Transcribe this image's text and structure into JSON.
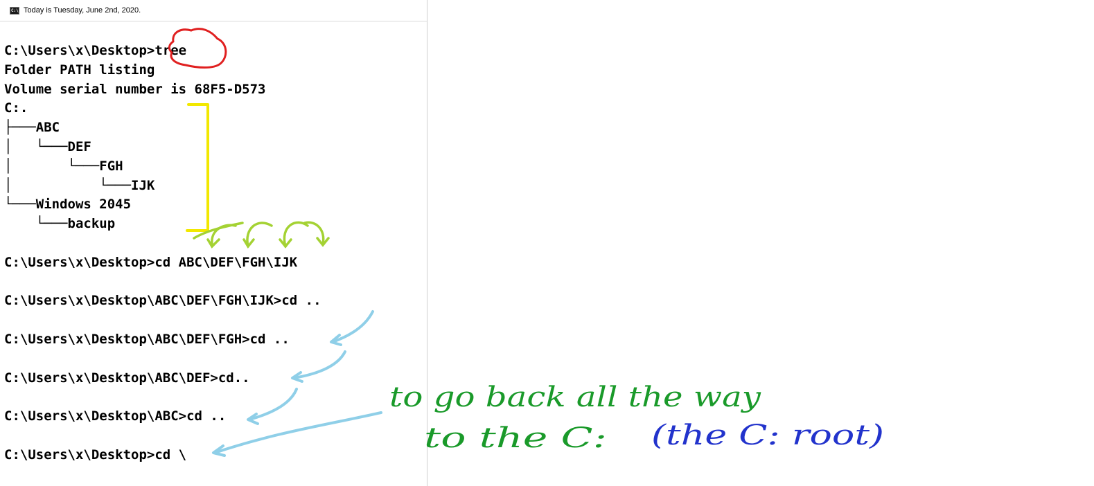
{
  "window": {
    "title": "Today is Tuesday, June 2nd, 2020.",
    "title_icon": "console-icon",
    "icon_glyph": "C:\\"
  },
  "console": {
    "lines": [
      "C:\\Users\\x\\Desktop>tree",
      "Folder PATH listing",
      "Volume serial number is 68F5-D573",
      "C:.",
      "├───ABC",
      "│   └───DEF",
      "│       └───FGH",
      "│           └───IJK",
      "└───Windows 2045",
      "    └───backup",
      "",
      "C:\\Users\\x\\Desktop>cd ABC\\DEF\\FGH\\IJK",
      "",
      "C:\\Users\\x\\Desktop\\ABC\\DEF\\FGH\\IJK>cd ..",
      "",
      "C:\\Users\\x\\Desktop\\ABC\\DEF\\FGH>cd ..",
      "",
      "C:\\Users\\x\\Desktop\\ABC\\DEF>cd..",
      "",
      "C:\\Users\\x\\Desktop\\ABC>cd ..",
      "",
      "C:\\Users\\x\\Desktop>cd \\"
    ]
  },
  "annotations": {
    "note_line1": "to go back all the way",
    "note_line2_green": "to the C:",
    "note_line2_blue": "(the C: root)",
    "colors": {
      "red_circle": "#e02020",
      "yellow_bracket": "#f2e800",
      "lime_arrows": "#a4d233",
      "blue_arrows": "#8fcfe8",
      "green_text": "#1a9a2a",
      "blue_text": "#2233cc"
    }
  }
}
